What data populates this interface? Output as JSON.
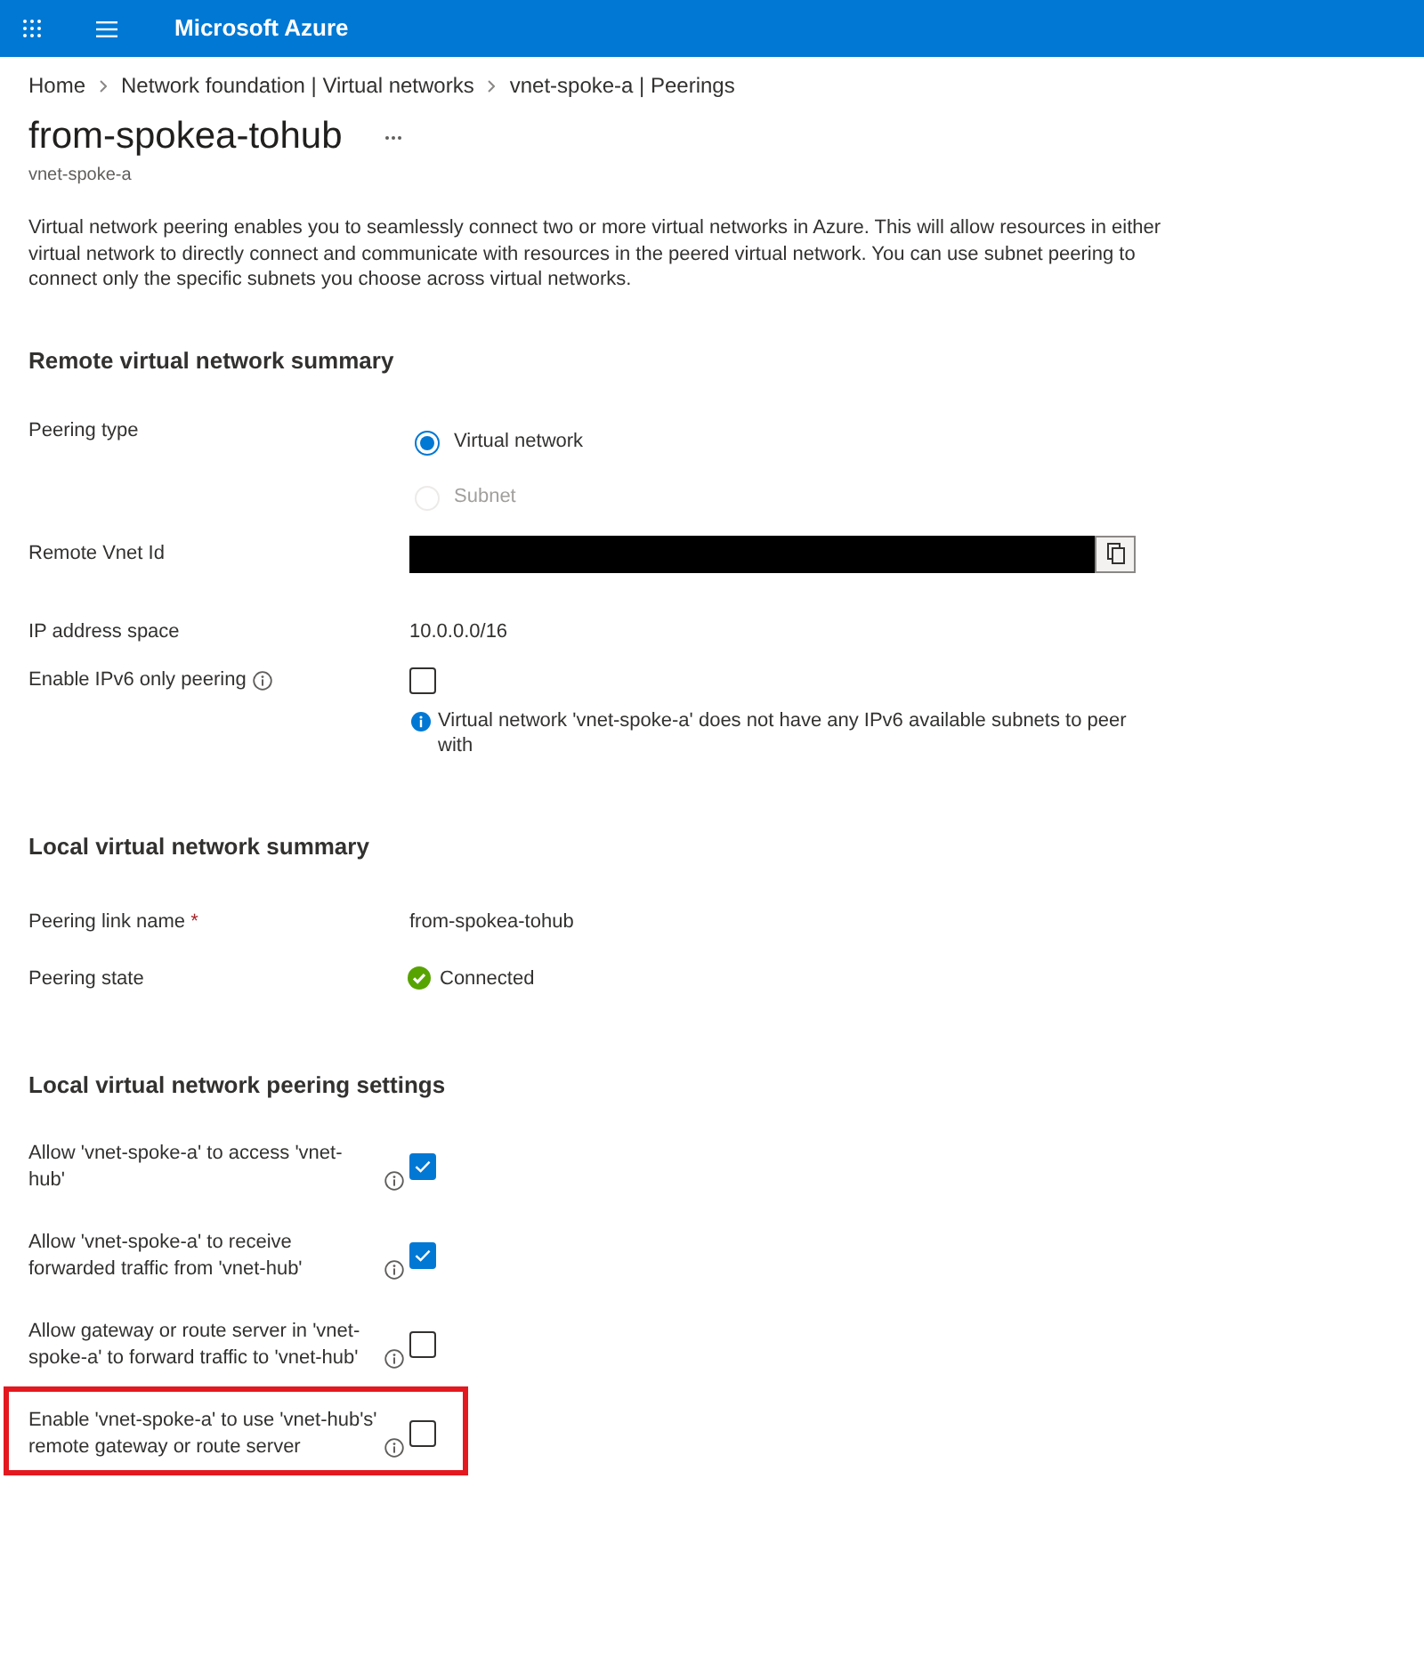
{
  "header": {
    "title": "Microsoft Azure"
  },
  "breadcrumb": [
    {
      "label": "Home"
    },
    {
      "label": "Network foundation | Virtual networks"
    },
    {
      "label": "vnet-spoke-a | Peerings"
    }
  ],
  "page": {
    "title": "from-spokea-tohub",
    "subtitle": "vnet-spoke-a",
    "description": "Virtual network peering enables you to seamlessly connect two or more virtual networks in Azure. This will allow resources in either virtual network to directly connect and communicate with resources in the peered virtual network. You can use subnet peering to connect only the specific subnets you choose across virtual networks."
  },
  "sections": [
    {
      "heading": "Remote virtual network summary",
      "rows": [
        {
          "kind": "radio_group",
          "label": "Peering type",
          "options": [
            {
              "label": "Virtual network",
              "selected": true,
              "disabled": false
            },
            {
              "label": "Subnet",
              "selected": false,
              "disabled": true
            }
          ]
        },
        {
          "kind": "copy_field",
          "label": "Remote Vnet Id",
          "redacted": true
        },
        {
          "kind": "text",
          "label": "IP address space",
          "value": "10.0.0.0/16"
        },
        {
          "kind": "checkbox",
          "label": "Enable IPv6 only peering",
          "info": true,
          "checked": false,
          "highlighted": false,
          "note": "Virtual network 'vnet-spoke-a' does not have any IPv6 available subnets to peer with"
        }
      ]
    },
    {
      "heading": "Local virtual network summary",
      "rows": [
        {
          "kind": "text",
          "label": "Peering link name",
          "required_mark": "*",
          "value": "from-spokea-tohub"
        },
        {
          "kind": "status",
          "label": "Peering state",
          "value": "Connected"
        }
      ]
    },
    {
      "heading": "Local virtual network peering settings",
      "rows": [
        {
          "kind": "checkbox",
          "label": "Allow 'vnet-spoke-a' to access 'vnet-hub'",
          "info": true,
          "checked": true,
          "highlighted": false
        },
        {
          "kind": "checkbox",
          "label": "Allow 'vnet-spoke-a' to receive forwarded traffic from 'vnet-hub'",
          "info": true,
          "checked": true,
          "highlighted": false
        },
        {
          "kind": "checkbox",
          "label": "Allow gateway or route server in 'vnet-spoke-a' to forward traffic to 'vnet-hub'",
          "info": true,
          "checked": false,
          "highlighted": false
        },
        {
          "kind": "checkbox",
          "label": "Enable 'vnet-spoke-a' to use 'vnet-hub's' remote gateway or route server",
          "info": true,
          "checked": false,
          "highlighted": true
        }
      ]
    }
  ]
}
